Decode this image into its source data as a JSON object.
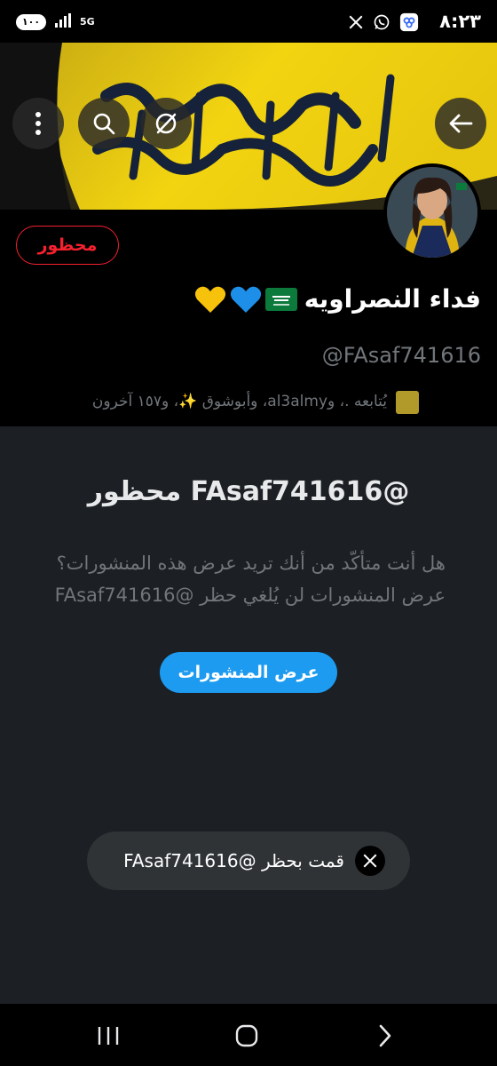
{
  "status_bar": {
    "time": "٨:٢٣",
    "battery": "١٠٠",
    "network": "5G",
    "app_icons": [
      "vpn-icon",
      "whatsapp-icon",
      "x-icon"
    ]
  },
  "banner": {
    "buttons": [
      "back-arrow-icon",
      "grok-icon",
      "search-icon",
      "more-vertical-icon"
    ]
  },
  "profile": {
    "blocked_label": "محظور",
    "display_name": "فداء النصراويه",
    "name_emojis": "🇸🇦💙💛",
    "handle": "@FAsaf741616",
    "followers_text": "يُتابعه .، وal3almy، وأبوشوق ✨، و١٥٧ آخرون"
  },
  "blocked_notice": {
    "title": "@FAsaf741616 محظور",
    "desc_line1": "هل أنت متأكّد من أنك تريد عرض هذه المنشورات؟",
    "desc_line2": "عرض المنشورات لن يُلغي حظر @FAsaf741616",
    "view_posts_label": "عرض المنشورات"
  },
  "toast": {
    "text": "قمت بحظر @FAsaf741616"
  },
  "nav_bar": {
    "buttons": [
      "recents-icon",
      "home-icon",
      "back-icon"
    ]
  },
  "colors": {
    "accent": "#1d9bf0",
    "danger": "#f4212e",
    "muted": "#71767b",
    "background": "#000000",
    "panel": "#1c1f23"
  }
}
